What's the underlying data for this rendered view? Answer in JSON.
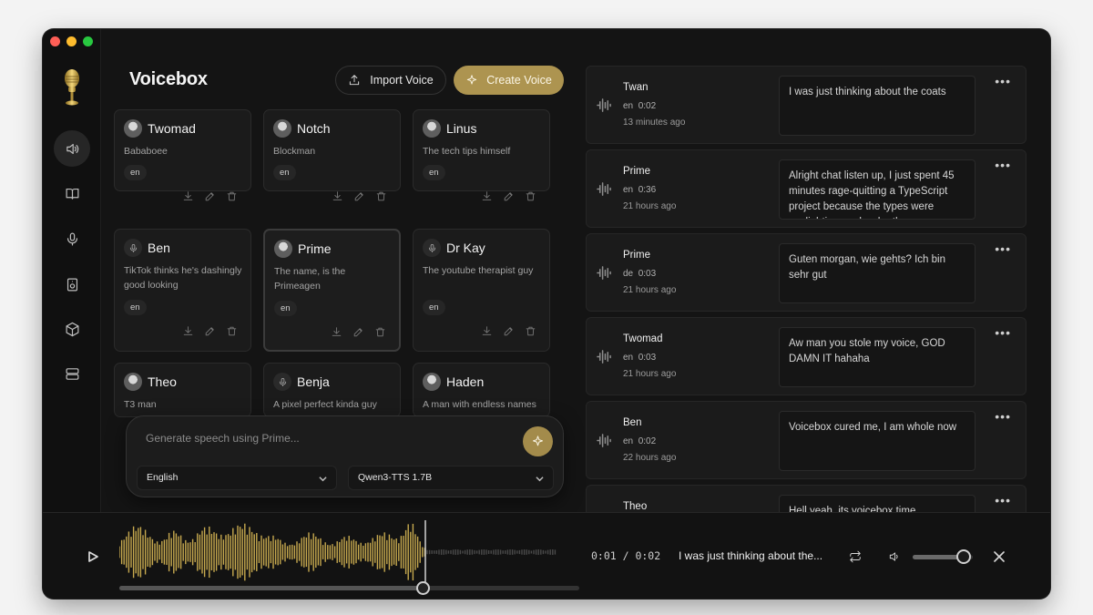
{
  "app": {
    "title": "Voicebox",
    "accent": "#ad9450"
  },
  "traffic_lights": [
    "#ff5f57",
    "#febc2e",
    "#28c840"
  ],
  "sidebar": {
    "items": [
      {
        "name": "voices",
        "icon": "speaker-icon",
        "active": true
      },
      {
        "name": "stories",
        "icon": "book-icon",
        "active": false
      },
      {
        "name": "record",
        "icon": "mic-icon",
        "active": false
      },
      {
        "name": "audio",
        "icon": "audio-device-icon",
        "active": false
      },
      {
        "name": "models",
        "icon": "cube-icon",
        "active": false
      },
      {
        "name": "server",
        "icon": "server-icon",
        "active": false
      }
    ]
  },
  "header": {
    "import_label": "Import Voice",
    "create_label": "Create Voice"
  },
  "voices": [
    {
      "name": "Twomad",
      "desc": "Bababoee",
      "lang": "en",
      "avatar": "photo"
    },
    {
      "name": "Notch",
      "desc": "Blockman",
      "lang": "en",
      "avatar": "photo"
    },
    {
      "name": "Linus",
      "desc": "The tech tips himself",
      "lang": "en",
      "avatar": "photo"
    },
    {
      "name": "Ben",
      "desc": "TikTok thinks he's dashingly good looking",
      "lang": "en",
      "avatar": "mic"
    },
    {
      "name": "Prime",
      "desc": "The name, is the Primeagen",
      "lang": "en",
      "avatar": "photo",
      "selected": true
    },
    {
      "name": "Dr Kay",
      "desc": "The youtube therapist guy",
      "lang": "en",
      "avatar": "mic"
    },
    {
      "name": "Theo",
      "desc": "T3 man",
      "lang": "en",
      "avatar": "photo"
    },
    {
      "name": "Benja",
      "desc": "A pixel perfect kinda guy",
      "lang": "en",
      "avatar": "mic"
    },
    {
      "name": "Haden",
      "desc": "A man with endless names",
      "lang": "en",
      "avatar": "photo"
    }
  ],
  "generate": {
    "placeholder": "Generate speech using Prime...",
    "language": "English",
    "model": "Qwen3-TTS 1.7B"
  },
  "history": [
    {
      "name": "Twan",
      "lang": "en",
      "duration": "0:02",
      "time": "13 minutes ago",
      "text": "I was just thinking about the coats"
    },
    {
      "name": "Prime",
      "lang": "en",
      "duration": "0:36",
      "time": "21 hours ago",
      "text": "Alright chat listen up, I just spent 45 minutes rage-quitting a TypeScript project because the types were gaslighting me harder than my ex"
    },
    {
      "name": "Prime",
      "lang": "de",
      "duration": "0:03",
      "time": "21 hours ago",
      "text": "Guten morgan, wie gehts? Ich bin sehr gut"
    },
    {
      "name": "Twomad",
      "lang": "en",
      "duration": "0:03",
      "time": "21 hours ago",
      "text": "Aw man you stole my voice, GOD DAMN IT hahaha"
    },
    {
      "name": "Ben",
      "lang": "en",
      "duration": "0:02",
      "time": "22 hours ago",
      "text": "Voicebox cured me, I am whole now"
    },
    {
      "name": "Theo",
      "lang": "",
      "duration": "",
      "time": "",
      "text": "Hell yeah, its voicebox time"
    }
  ],
  "player": {
    "time_display": "0:01 / 0:02",
    "now_playing": "I was just thinking about the...",
    "progress": 0.66,
    "volume": 0.85
  }
}
